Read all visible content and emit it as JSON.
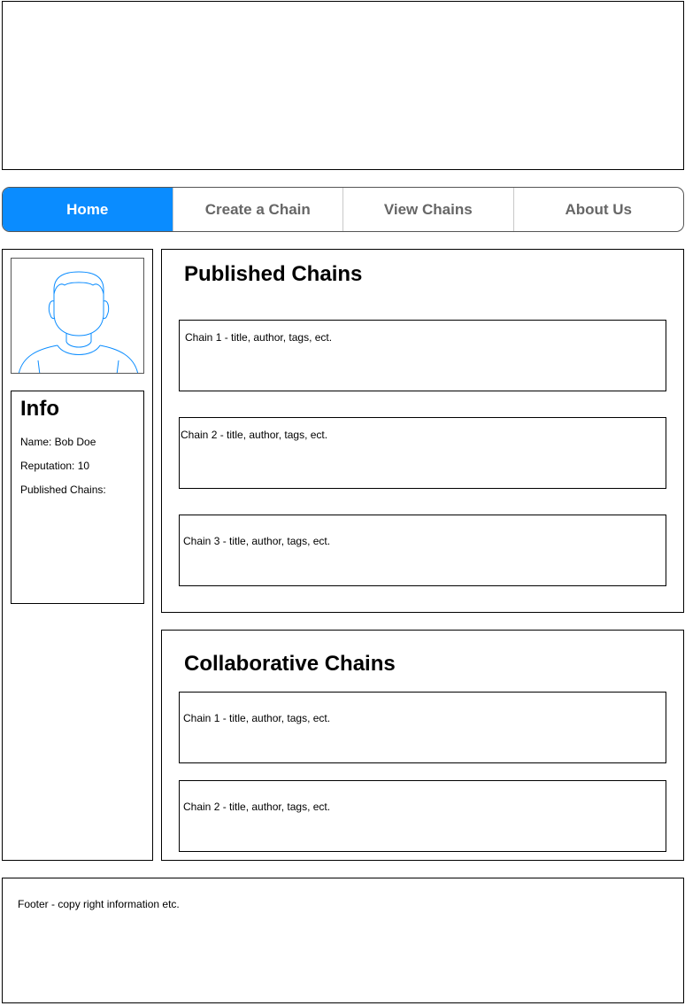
{
  "nav": {
    "tabs": [
      {
        "label": "Home",
        "active": true
      },
      {
        "label": "Create a Chain",
        "active": false
      },
      {
        "label": "View Chains",
        "active": false
      },
      {
        "label": "About Us",
        "active": false
      }
    ]
  },
  "sidebar": {
    "avatar_icon": "user-avatar-icon",
    "info": {
      "title": "Info",
      "name": "Name: Bob Doe",
      "reputation": "Reputation: 10",
      "published_chains": "Published Chains:"
    }
  },
  "published": {
    "title": "Published Chains",
    "chains": [
      "Chain 1 - title, author, tags, ect.",
      "Chain 2 - title, author, tags, ect.",
      "Chain 3 - title, author, tags, ect."
    ]
  },
  "collaborative": {
    "title": "Collaborative Chains",
    "chains": [
      "Chain 1 - title, author, tags, ect.",
      "Chain 2 - title, author, tags, ect."
    ]
  },
  "footer": {
    "text": "Footer - copy right information etc."
  },
  "colors": {
    "accent": "#0a8cff",
    "avatar_stroke": "#0a8cff",
    "nav_text": "#666666"
  }
}
